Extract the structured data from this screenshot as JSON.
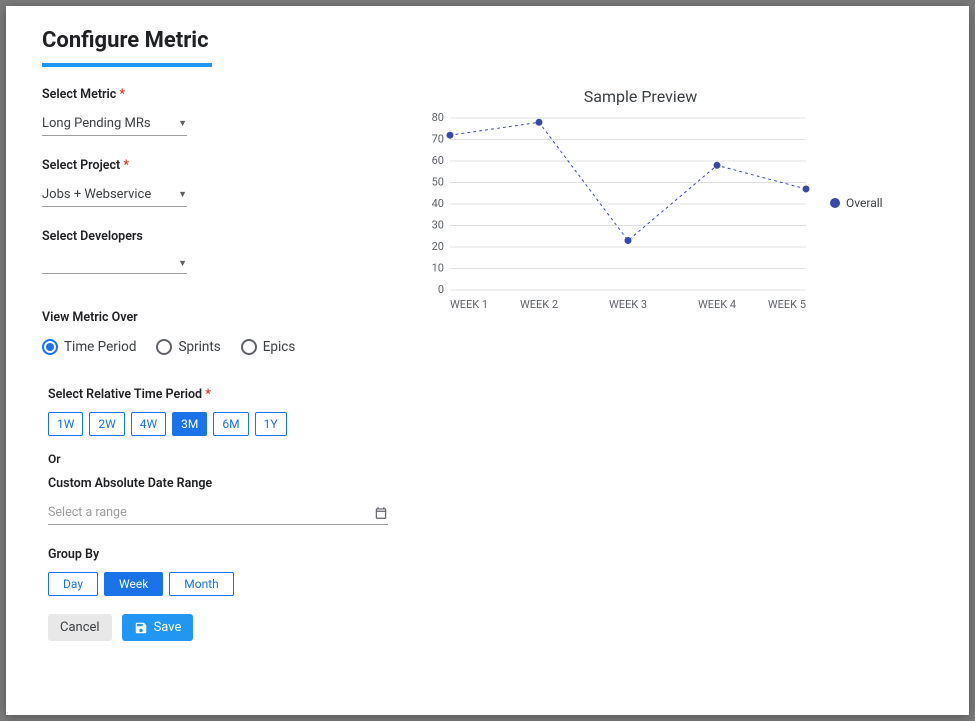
{
  "title": "Configure Metric",
  "form": {
    "metric": {
      "label": "Select Metric",
      "value": "Long Pending MRs"
    },
    "project": {
      "label": "Select Project",
      "value": "Jobs + Webservice"
    },
    "developers": {
      "label": "Select Developers",
      "value": ""
    },
    "view_over": {
      "label": "View Metric Over",
      "options": [
        "Time Period",
        "Sprints",
        "Epics"
      ],
      "selected": "Time Period"
    },
    "time_period": {
      "label": "Select Relative Time Period",
      "options": [
        "1W",
        "2W",
        "4W",
        "3M",
        "6M",
        "1Y"
      ],
      "selected": "3M"
    },
    "or_label": "Or",
    "date_range": {
      "label": "Custom Absolute Date Range",
      "placeholder": "Select a range",
      "value": ""
    },
    "group_by": {
      "label": "Group By",
      "options": [
        "Day",
        "Week",
        "Month"
      ],
      "selected": "Week"
    },
    "actions": {
      "cancel": "Cancel",
      "save": "Save"
    }
  },
  "preview": {
    "title": "Sample Preview",
    "legend": "Overall"
  },
  "chart_data": {
    "type": "line",
    "categories": [
      "WEEK 1",
      "WEEK 2",
      "WEEK 3",
      "WEEK 4",
      "WEEK 5"
    ],
    "series": [
      {
        "name": "Overall",
        "values": [
          72,
          78,
          23,
          58,
          47
        ]
      }
    ],
    "title": "Sample Preview",
    "xlabel": "",
    "ylabel": "",
    "ylim": [
      0,
      80
    ],
    "yticks": [
      0,
      10,
      20,
      30,
      40,
      50,
      60,
      70,
      80
    ],
    "grid": true
  }
}
